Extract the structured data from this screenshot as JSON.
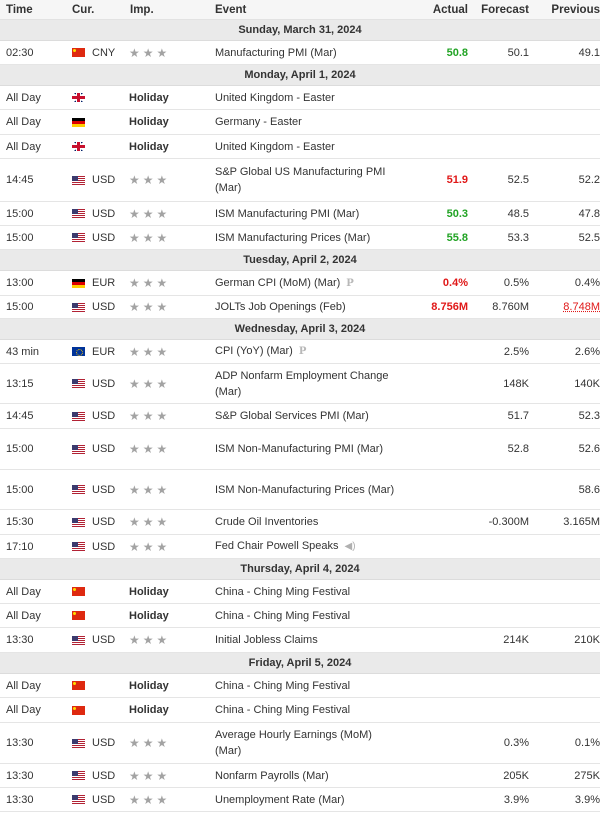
{
  "headers": {
    "time": "Time",
    "currency": "Cur.",
    "importance": "Imp.",
    "event": "Event",
    "actual": "Actual",
    "forecast": "Forecast",
    "previous": "Previous"
  },
  "colors": {
    "actual_better": "#21a324",
    "actual_worse": "#e01818",
    "star_inactive": "#a3a3a3",
    "day_header_bg": "#eaeaea"
  },
  "days": [
    {
      "label": "Sunday, March 31, 2024",
      "events": [
        {
          "time": "02:30",
          "flag": "flag-cn",
          "currency": "CNY",
          "importance": 3,
          "holiday": "",
          "event": "Manufacturing PMI (Mar)",
          "actual": "50.8",
          "actual_color": "green",
          "forecast": "50.1",
          "previous": "49.1",
          "prev_color": "",
          "icon": "",
          "h": 24
        }
      ]
    },
    {
      "label": "Monday, April 1, 2024",
      "events": [
        {
          "time": "All Day",
          "flag": "flag-gb",
          "currency": "",
          "importance": 0,
          "holiday": "Holiday",
          "event": "United Kingdom - Easter",
          "actual": "",
          "actual_color": "",
          "forecast": "",
          "previous": "",
          "prev_color": "",
          "icon": "",
          "h": 24
        },
        {
          "time": "All Day",
          "flag": "flag-de",
          "currency": "",
          "importance": 0,
          "holiday": "Holiday",
          "event": "Germany - Easter",
          "actual": "",
          "actual_color": "",
          "forecast": "",
          "previous": "",
          "prev_color": "",
          "icon": "",
          "h": 25
        },
        {
          "time": "All Day",
          "flag": "flag-gb",
          "currency": "",
          "importance": 0,
          "holiday": "Holiday",
          "event": "United Kingdom - Easter",
          "actual": "",
          "actual_color": "",
          "forecast": "",
          "previous": "",
          "prev_color": "",
          "icon": "",
          "h": 24
        },
        {
          "time": "14:45",
          "flag": "flag-us",
          "currency": "USD",
          "importance": 3,
          "holiday": "",
          "event": "S&P Global US Manufacturing PMI (Mar)",
          "actual": "51.9",
          "actual_color": "red",
          "forecast": "52.5",
          "previous": "52.2",
          "prev_color": "",
          "icon": "",
          "h": 43
        },
        {
          "time": "15:00",
          "flag": "flag-us",
          "currency": "USD",
          "importance": 3,
          "holiday": "",
          "event": "ISM Manufacturing PMI (Mar)",
          "actual": "50.3",
          "actual_color": "green",
          "forecast": "48.5",
          "previous": "47.8",
          "prev_color": "",
          "icon": "",
          "h": 24
        },
        {
          "time": "15:00",
          "flag": "flag-us",
          "currency": "USD",
          "importance": 3,
          "holiday": "",
          "event": "ISM Manufacturing Prices (Mar)",
          "actual": "55.8",
          "actual_color": "green",
          "forecast": "53.3",
          "previous": "52.5",
          "prev_color": "",
          "icon": "",
          "h": 24
        }
      ]
    },
    {
      "label": "Tuesday, April 2, 2024",
      "events": [
        {
          "time": "13:00",
          "flag": "flag-de",
          "currency": "EUR",
          "importance": 3,
          "holiday": "",
          "event": "German CPI (MoM) (Mar)",
          "actual": "0.4%",
          "actual_color": "red",
          "forecast": "0.5%",
          "previous": "0.4%",
          "prev_color": "",
          "icon": "P",
          "h": 25
        },
        {
          "time": "15:00",
          "flag": "flag-us",
          "currency": "USD",
          "importance": 3,
          "holiday": "",
          "event": "JOLTs Job Openings (Feb)",
          "actual": "8.756M",
          "actual_color": "red",
          "forecast": "8.760M",
          "previous": "8.748M",
          "prev_color": "red",
          "icon": "",
          "h": 23
        }
      ]
    },
    {
      "label": "Wednesday, April 3, 2024",
      "events": [
        {
          "time": "43 min",
          "flag": "flag-eu",
          "currency": "EUR",
          "importance": 3,
          "holiday": "",
          "event": "CPI (YoY) (Mar)",
          "actual": "",
          "actual_color": "",
          "forecast": "2.5%",
          "previous": "2.6%",
          "prev_color": "",
          "icon": "P",
          "h": 24
        },
        {
          "time": "13:15",
          "flag": "flag-us",
          "currency": "USD",
          "importance": 3,
          "holiday": "",
          "event": "ADP Nonfarm Employment Change (Mar)",
          "actual": "",
          "actual_color": "",
          "forecast": "148K",
          "previous": "140K",
          "prev_color": "",
          "icon": "",
          "h": 40
        },
        {
          "time": "14:45",
          "flag": "flag-us",
          "currency": "USD",
          "importance": 3,
          "holiday": "",
          "event": "S&P Global Services PMI (Mar)",
          "actual": "",
          "actual_color": "",
          "forecast": "51.7",
          "previous": "52.3",
          "prev_color": "",
          "icon": "",
          "h": 25
        },
        {
          "time": "15:00",
          "flag": "flag-us",
          "currency": "USD",
          "importance": 3,
          "holiday": "",
          "event": "ISM Non-Manufacturing PMI (Mar)",
          "actual": "",
          "actual_color": "",
          "forecast": "52.8",
          "previous": "52.6",
          "prev_color": "",
          "icon": "",
          "h": 41
        },
        {
          "time": "15:00",
          "flag": "flag-us",
          "currency": "USD",
          "importance": 3,
          "holiday": "",
          "event": "ISM Non-Manufacturing Prices (Mar)",
          "actual": "",
          "actual_color": "",
          "forecast": "",
          "previous": "58.6",
          "prev_color": "",
          "icon": "",
          "h": 40
        },
        {
          "time": "15:30",
          "flag": "flag-us",
          "currency": "USD",
          "importance": 3,
          "holiday": "",
          "event": "Crude Oil Inventories",
          "actual": "",
          "actual_color": "",
          "forecast": "-0.300M",
          "previous": "3.165M",
          "prev_color": "",
          "icon": "",
          "h": 25
        },
        {
          "time": "17:10",
          "flag": "flag-us",
          "currency": "USD",
          "importance": 3,
          "holiday": "",
          "event": "Fed Chair Powell Speaks",
          "actual": "",
          "actual_color": "",
          "forecast": "",
          "previous": "",
          "prev_color": "",
          "icon": "speaker",
          "h": 24
        }
      ]
    },
    {
      "label": "Thursday, April 4, 2024",
      "events": [
        {
          "time": "All Day",
          "flag": "flag-cn",
          "currency": "",
          "importance": 0,
          "holiday": "Holiday",
          "event": "China - Ching Ming Festival",
          "actual": "",
          "actual_color": "",
          "forecast": "",
          "previous": "",
          "prev_color": "",
          "icon": "",
          "h": 24
        },
        {
          "time": "All Day",
          "flag": "flag-cn",
          "currency": "",
          "importance": 0,
          "holiday": "Holiday",
          "event": "China - Ching Ming Festival",
          "actual": "",
          "actual_color": "",
          "forecast": "",
          "previous": "",
          "prev_color": "",
          "icon": "",
          "h": 24
        },
        {
          "time": "13:30",
          "flag": "flag-us",
          "currency": "USD",
          "importance": 3,
          "holiday": "",
          "event": "Initial Jobless Claims",
          "actual": "",
          "actual_color": "",
          "forecast": "214K",
          "previous": "210K",
          "prev_color": "",
          "icon": "",
          "h": 25
        }
      ]
    },
    {
      "label": "Friday, April 5, 2024",
      "events": [
        {
          "time": "All Day",
          "flag": "flag-cn",
          "currency": "",
          "importance": 0,
          "holiday": "Holiday",
          "event": "China - Ching Ming Festival",
          "actual": "",
          "actual_color": "",
          "forecast": "",
          "previous": "",
          "prev_color": "",
          "icon": "",
          "h": 24
        },
        {
          "time": "All Day",
          "flag": "flag-cn",
          "currency": "",
          "importance": 0,
          "holiday": "Holiday",
          "event": "China - Ching Ming Festival",
          "actual": "",
          "actual_color": "",
          "forecast": "",
          "previous": "",
          "prev_color": "",
          "icon": "",
          "h": 25
        },
        {
          "time": "13:30",
          "flag": "flag-us",
          "currency": "USD",
          "importance": 3,
          "holiday": "",
          "event": "Average Hourly Earnings (MoM) (Mar)",
          "actual": "",
          "actual_color": "",
          "forecast": "0.3%",
          "previous": "0.1%",
          "prev_color": "",
          "icon": "",
          "h": 41
        },
        {
          "time": "13:30",
          "flag": "flag-us",
          "currency": "USD",
          "importance": 3,
          "holiday": "",
          "event": "Nonfarm Payrolls (Mar)",
          "actual": "",
          "actual_color": "",
          "forecast": "205K",
          "previous": "275K",
          "prev_color": "",
          "icon": "",
          "h": 24
        },
        {
          "time": "13:30",
          "flag": "flag-us",
          "currency": "USD",
          "importance": 3,
          "holiday": "",
          "event": "Unemployment Rate (Mar)",
          "actual": "",
          "actual_color": "",
          "forecast": "3.9%",
          "previous": "3.9%",
          "prev_color": "",
          "icon": "",
          "h": 24
        }
      ]
    }
  ]
}
